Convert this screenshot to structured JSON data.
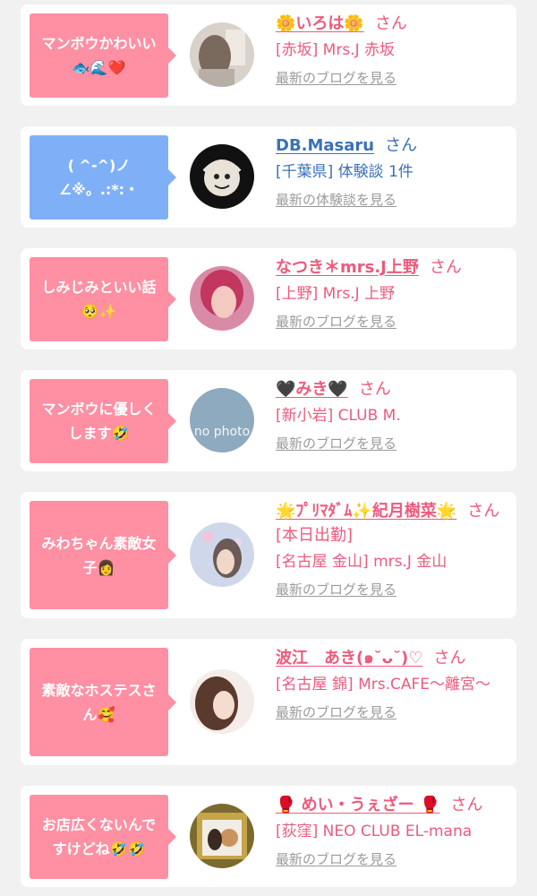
{
  "cards": [
    {
      "bubble_line1": "マンボウかわいい",
      "bubble_line2": "🐟🌊❤️",
      "name": "🌼いろは🌼",
      "san": "さん",
      "shop": "[赤坂] Mrs.J 赤坂",
      "link": "最新のブログを見る"
    },
    {
      "bubble_line1": "( ^-^)ノ",
      "bubble_line2": "∠※。.:*:・",
      "name": "DB.Masaru",
      "san": "さん",
      "shop": "[千葉県] 体験談 1件",
      "link": "最新の体験談を見る"
    },
    {
      "bubble_line1": "しみじみといい話",
      "bubble_line2": "🥺✨",
      "name": "なつき＊mrs.J上野",
      "san": "さん",
      "shop": "[上野] Mrs.J 上野",
      "link": "最新のブログを見る"
    },
    {
      "bubble_line1": "マンボウに優しく",
      "bubble_line2": "します🤣",
      "name": "🖤みき🖤",
      "san": "さん",
      "shop": "[新小岩] CLUB M.",
      "link": "最新のブログを見る",
      "avatar_text": "no photo"
    },
    {
      "bubble_line1": "みわちゃん素敵女",
      "bubble_line2": "子👩",
      "name": "🌟ﾌﾟﾘﾏﾀﾞﾑ✨紀月樹菜🌟",
      "san": "さん[本日出勤]",
      "shop": "[名古屋 金山] mrs.J 金山",
      "link": "最新のブログを見る"
    },
    {
      "bubble_line1": "素敵なホステスさ",
      "bubble_line2": "ん🥰",
      "name": "波江　あき(๑˘ᴗ˘)♡",
      "san": "さん",
      "shop": "[名古屋 錦] Mrs.CAFE〜離宮〜",
      "link": "最新のブログを見る"
    },
    {
      "bubble_line1": "お店広くないんで",
      "bubble_line2": "すけどね🤣🤣",
      "name": "🥊 めい・うぇざー 🥊",
      "san": "さん",
      "shop": "[荻窪] NEO CLUB EL-mana",
      "link": "最新のブログを見る"
    }
  ],
  "colors": {
    "accent_pink": "#ee5a7c",
    "accent_blue": "#3a72b8",
    "bubble_pink": "#ff8fa3",
    "bubble_blue": "#7fb0f7"
  }
}
